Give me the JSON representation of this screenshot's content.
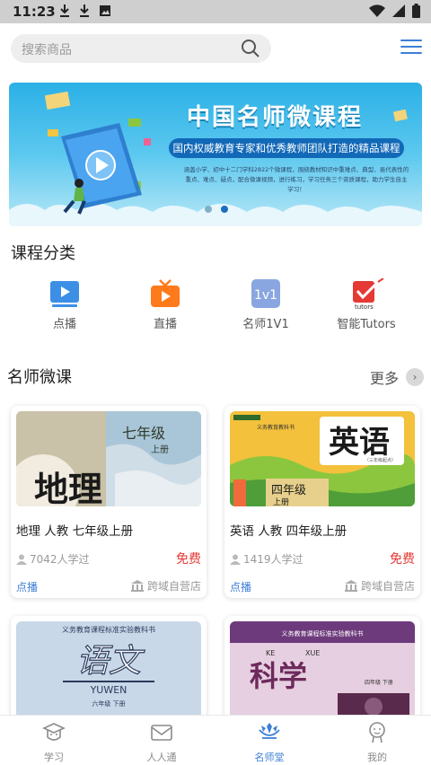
{
  "status_bar": {
    "time": "11:23"
  },
  "search": {
    "placeholder": "搜索商品"
  },
  "banner": {
    "title": "中国名师微课程",
    "subtitle": "国内权威教育专家和优秀教师团队打造的精品课程",
    "description": "涵盖小学、初中十二门学科2822个微课程，围绕教材知识中重难点、典型、易代表性的重点、难点、疑点，配合微课视频，进行练习，学习任务三个资质课程，助力学生自主学习！",
    "slides": 2,
    "active_slide": 2
  },
  "categories": {
    "title": "课程分类",
    "items": [
      {
        "label": "点播",
        "icon": "video-play-icon",
        "color": "#3d8fe6"
      },
      {
        "label": "直播",
        "icon": "live-tv-icon",
        "color": "#ff7a1a"
      },
      {
        "label": "名师1V1",
        "icon": "one-on-one-icon",
        "color": "#7b9bd8",
        "glyph": "1v1"
      },
      {
        "label": "智能Tutors",
        "icon": "tutors-icon",
        "color": "#e53935",
        "glyph": "tutors"
      }
    ]
  },
  "micro_courses": {
    "title": "名师微课",
    "more_label": "更多",
    "courses": [
      {
        "name": "地理 人教 七年级上册",
        "cover_grade": "七年级",
        "cover_term": "上册",
        "cover_subject": "地理",
        "learners": "7042人学过",
        "price": "免费",
        "type": "点播",
        "store": "跨域自营店"
      },
      {
        "name": "英语 人教 四年级上册",
        "cover_series": "义务教育教科书",
        "cover_subject": "英语",
        "cover_start": "（三年级起点）",
        "cover_grade": "四年级",
        "cover_term": "上册",
        "learners": "1419人学过",
        "price": "免费",
        "type": "点播",
        "store": "跨域自营店"
      },
      {
        "cover_series": "义务教育课程标准实验教科书",
        "cover_subject": "语文",
        "cover_pinyin": "YUWEN",
        "cover_grade": "六年级 下册"
      },
      {
        "cover_series": "义务教育课程标准实验教科书",
        "cover_subject": "科学",
        "cover_pinyin_1": "KE",
        "cover_pinyin_2": "XUE",
        "cover_grade": "四年级 下册"
      }
    ]
  },
  "bottom_nav": {
    "items": [
      {
        "label": "学习",
        "icon": "study-icon"
      },
      {
        "label": "人人通",
        "icon": "mail-icon"
      },
      {
        "label": "名师堂",
        "icon": "teacher-hall-icon",
        "active": true
      },
      {
        "label": "我的",
        "icon": "profile-icon"
      }
    ],
    "accent": "#3d7fd6"
  }
}
